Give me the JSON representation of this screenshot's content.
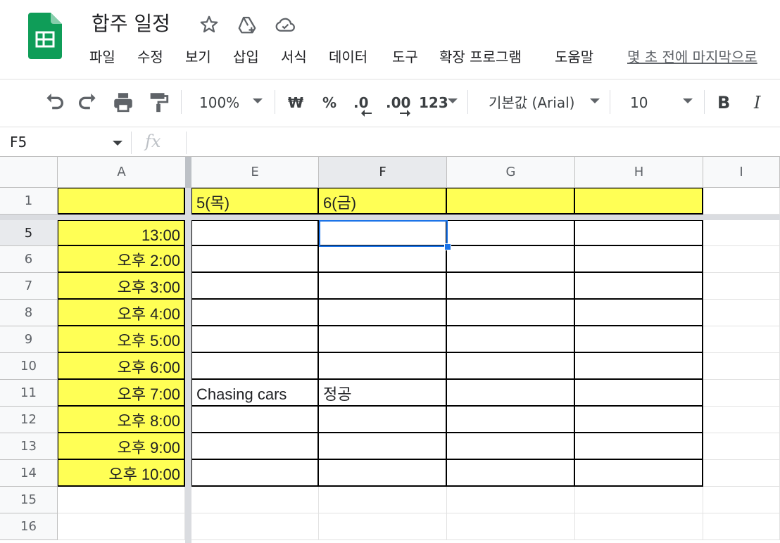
{
  "app": {
    "title": "합주 일정",
    "menu": [
      "파일",
      "수정",
      "보기",
      "삽입",
      "서식",
      "데이터",
      "도구",
      "확장 프로그램",
      "도움말"
    ],
    "last_edit": "몇 초 전에 마지막으로",
    "brand_color": "#0f9d58"
  },
  "toolbar": {
    "zoom": "100%",
    "currency": "₩",
    "percent": "%",
    "dec_decrease": ".0",
    "dec_increase": ".00",
    "number_format": "123",
    "font": "기본값 (Arial)",
    "font_size": "10",
    "bold": "B",
    "italic": "I"
  },
  "formula_bar": {
    "name_box": "F5",
    "fx": "fx",
    "value": ""
  },
  "sheet": {
    "columns": [
      "A",
      "E",
      "F",
      "G",
      "H",
      "I"
    ],
    "selected_column": "F",
    "rows": [
      "1",
      "5",
      "6",
      "7",
      "8",
      "9",
      "10",
      "11",
      "12",
      "13",
      "14",
      "15",
      "16"
    ],
    "selected_row": "5",
    "highlight_color": "#ffff55",
    "cells": {
      "E1": "5(목)",
      "F1": "6(금)",
      "A5": "13:00",
      "A6": "오후 2:00",
      "A7": "오후 3:00",
      "A8": "오후 4:00",
      "A9": "오후 5:00",
      "A10": "오후 6:00",
      "A11": "오후 7:00",
      "A12": "오후 8:00",
      "A13": "오후 9:00",
      "A14": "오후 10:00",
      "E11": "Chasing cars",
      "F11": "정공"
    }
  }
}
